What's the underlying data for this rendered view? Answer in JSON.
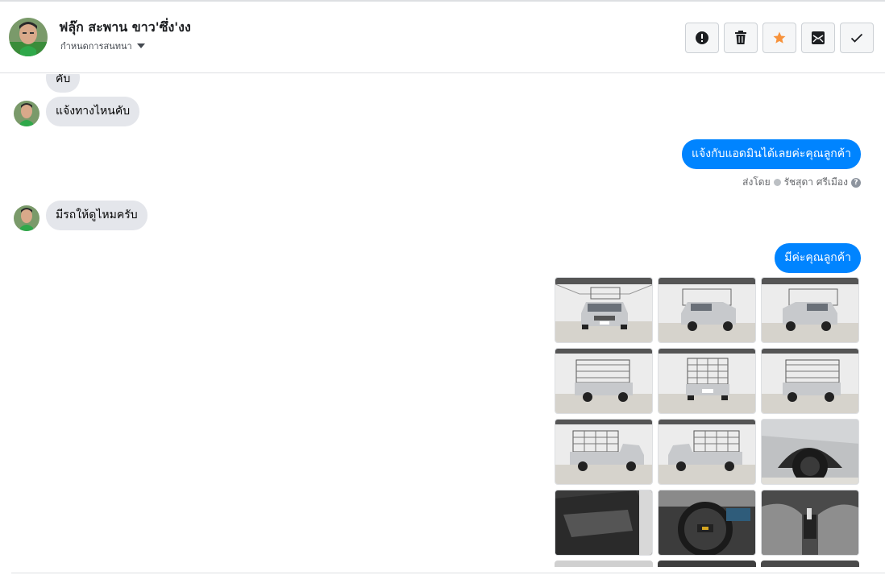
{
  "header": {
    "name": "ฟลุ๊ก สะพาน ขาว'ซึ่ง'งง",
    "subtitle": "กำหนดการสนทนา",
    "actions": [
      {
        "name": "report",
        "icon": "exclamation-icon"
      },
      {
        "name": "delete",
        "icon": "trash-icon"
      },
      {
        "name": "star",
        "icon": "star-icon",
        "color": "#f7923b"
      },
      {
        "name": "mark-unread",
        "icon": "envelope-icon"
      },
      {
        "name": "done",
        "icon": "check-icon"
      }
    ]
  },
  "messages": {
    "m0": "คับ",
    "m1": "แจ้งทางไหนคับ",
    "m2": "แจ้งกับแอดมินได้เลยค่ะคุณลูกค้า",
    "m3": "มีรถให้ดูไหมครับ",
    "m4": "มีค่ะคุณลูกค้า"
  },
  "sent_by": {
    "prefix": "ส่งโดย",
    "author": "รัชสุดา ศรีเมือง"
  },
  "photos": {
    "count_visible": 12,
    "kinds": [
      "truck-front",
      "truck-front-left",
      "truck-front-right",
      "truck-rear-left",
      "truck-rear",
      "truck-rear-right",
      "truck-side",
      "truck-side",
      "wheel",
      "door-interior",
      "steering-wheel",
      "seats"
    ]
  },
  "colors": {
    "outgoing_bubble": "#0084ff",
    "incoming_bubble": "#e4e6eb",
    "star": "#f7923b"
  }
}
